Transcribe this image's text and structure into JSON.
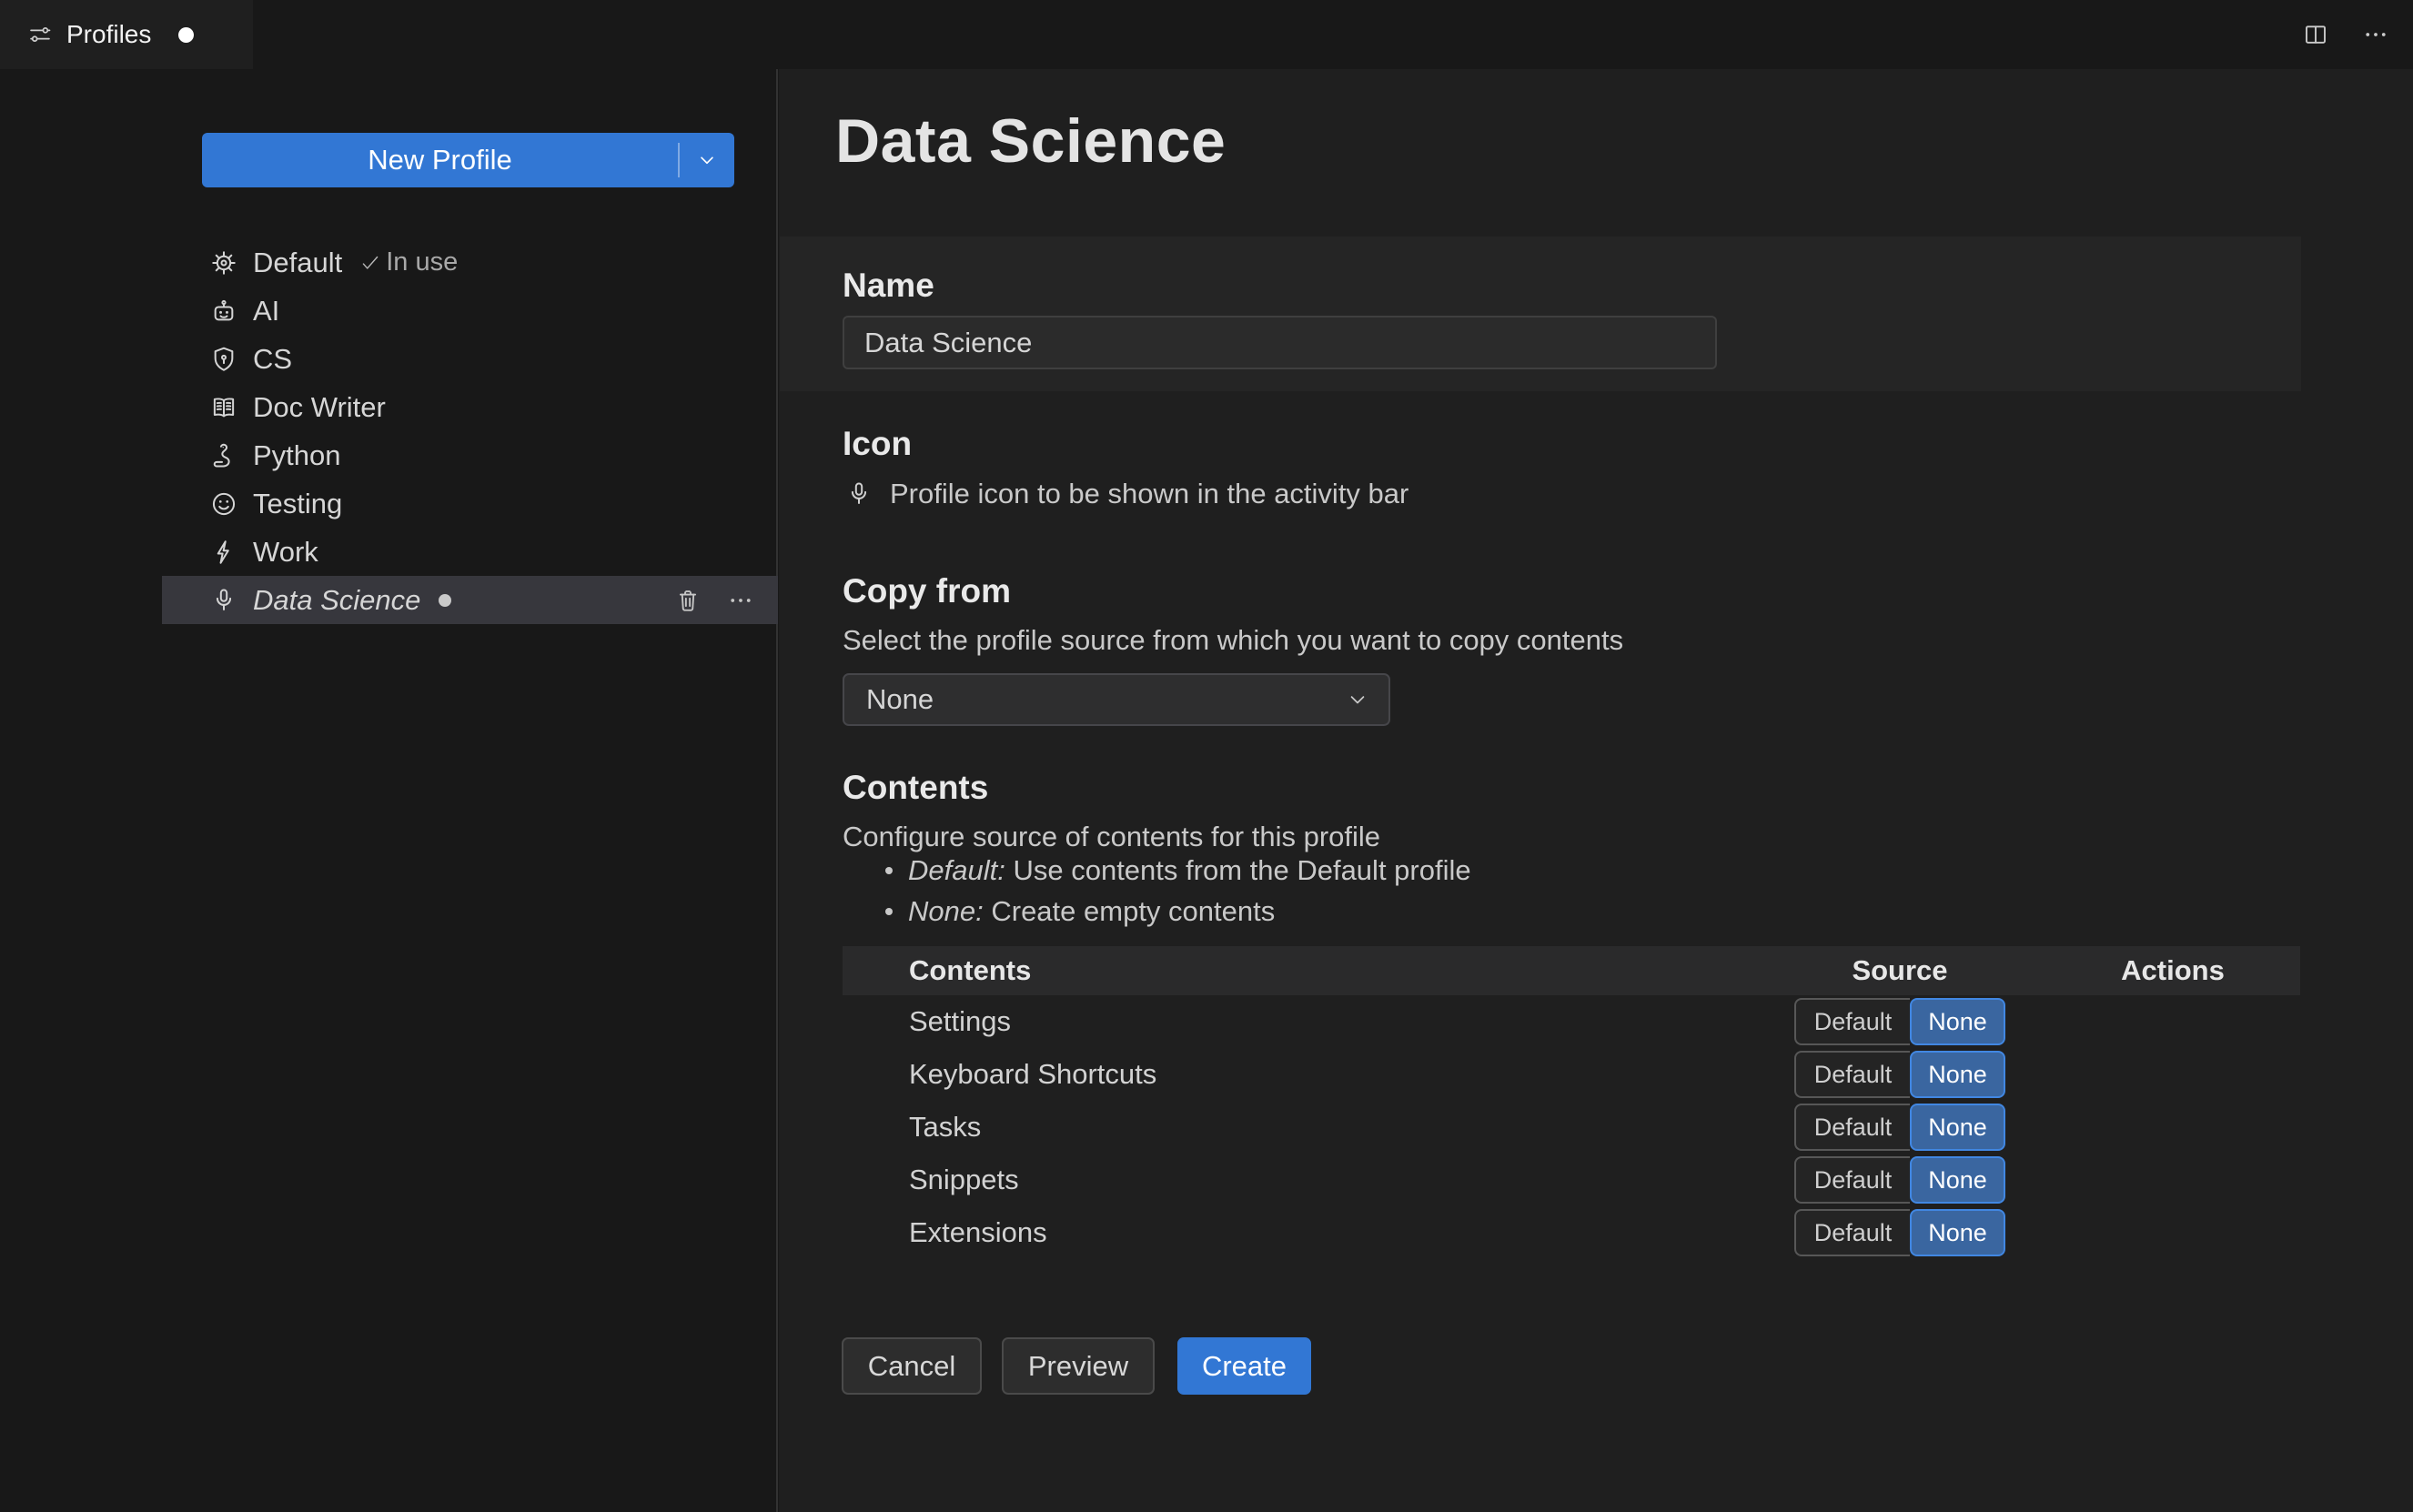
{
  "colors": {
    "accent": "#3277d4",
    "toggle_selected_bg": "#3a66a0",
    "toggle_selected_border": "#4187e2",
    "list_selected_bg": "#37373d"
  },
  "tab_bar": {
    "tab": {
      "title": "Profiles",
      "icon": "sliders",
      "modified": true
    },
    "actions": [
      {
        "icon": "split-editor"
      },
      {
        "icon": "ellipsis"
      }
    ]
  },
  "sidebar": {
    "new_profile_button": {
      "label": "New Profile",
      "dropdown_icon": "chevron-down"
    },
    "profiles": [
      {
        "name": "Default",
        "icon": "gear",
        "in_use": true,
        "in_use_label": "In use"
      },
      {
        "name": "AI",
        "icon": "robot"
      },
      {
        "name": "CS",
        "icon": "shield"
      },
      {
        "name": "Doc Writer",
        "icon": "book"
      },
      {
        "name": "Python",
        "icon": "snake"
      },
      {
        "name": "Testing",
        "icon": "smiley"
      },
      {
        "name": "Work",
        "icon": "zap"
      },
      {
        "name": "Data Science",
        "icon": "mic",
        "selected": true,
        "modified": true,
        "actions": [
          "trash",
          "ellipsis"
        ]
      }
    ]
  },
  "main": {
    "title": "Data Science",
    "name_section": {
      "label": "Name",
      "value": "Data Science"
    },
    "icon_section": {
      "label": "Icon",
      "icon": "mic",
      "description": "Profile icon to be shown in the activity bar"
    },
    "copy_from_section": {
      "label": "Copy from",
      "description": "Select the profile source from which you want to copy contents",
      "selected_option": "None",
      "dropdown_icon": "chevron-down"
    },
    "contents_section": {
      "label": "Contents",
      "description": "Configure source of contents for this profile",
      "bullets": [
        {
          "term": "Default:",
          "text": "Use contents from the Default profile"
        },
        {
          "term": "None:",
          "text": "Create empty contents"
        }
      ],
      "table": {
        "headers": [
          "Contents",
          "Source",
          "Actions"
        ],
        "source_options": [
          "Default",
          "None"
        ],
        "rows": [
          {
            "name": "Settings",
            "source": "None"
          },
          {
            "name": "Keyboard Shortcuts",
            "source": "None"
          },
          {
            "name": "Tasks",
            "source": "None"
          },
          {
            "name": "Snippets",
            "source": "None"
          },
          {
            "name": "Extensions",
            "source": "None"
          }
        ]
      }
    },
    "footer_buttons": {
      "cancel": "Cancel",
      "preview": "Preview",
      "create": "Create"
    }
  }
}
